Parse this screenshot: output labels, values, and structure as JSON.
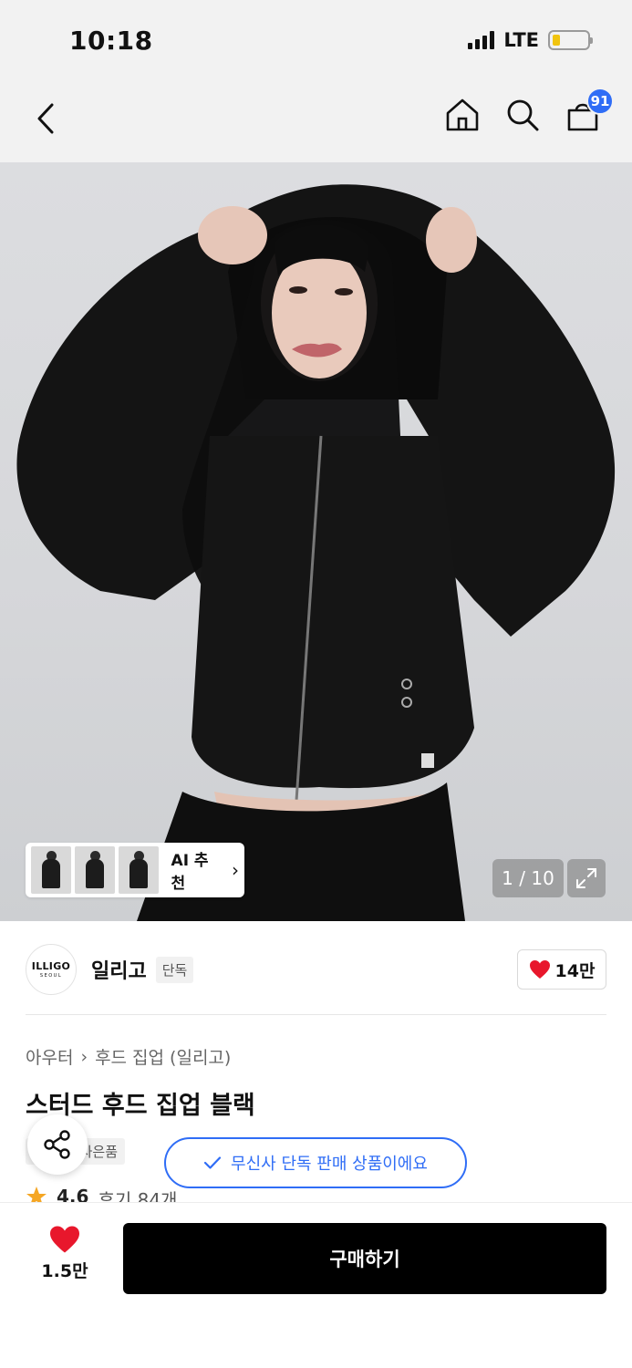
{
  "status_bar": {
    "time": "10:18",
    "network": "LTE"
  },
  "header": {
    "cart_count": "91"
  },
  "gallery": {
    "ai_recommend_label": "AI 추천",
    "counter": "1 / 10"
  },
  "brand": {
    "logo_text": "ILLIGO",
    "logo_sub": "SEOUL",
    "name": "일리고",
    "tag": "단독",
    "likes": "14만"
  },
  "breadcrumb": [
    "아우터",
    "후드 집업 (일리고)"
  ],
  "product": {
    "title": "스터드 후드 집업 블랙",
    "tags": [
      "단독",
      "사은품"
    ],
    "exclusive_notice": "무신사 단독 판매 상품이에요",
    "rating": "4.6",
    "reviews": "후기 84개"
  },
  "bottom": {
    "wish_count": "1.5만",
    "buy_label": "구매하기"
  },
  "colors": {
    "accent": "#2f6df6",
    "heart": "#e8172c",
    "buy_bg": "#000000"
  }
}
